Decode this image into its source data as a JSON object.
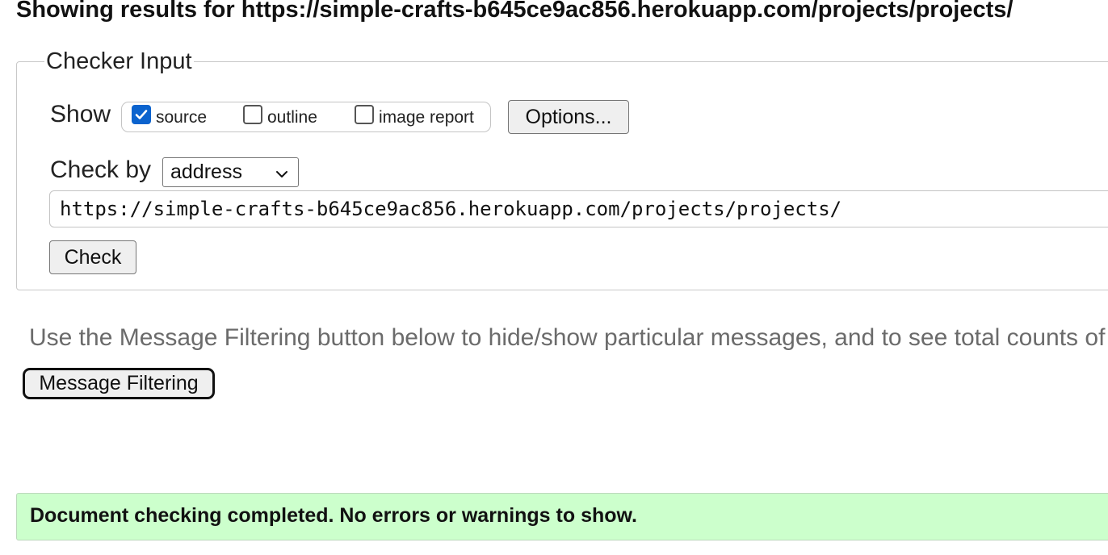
{
  "heading": "Showing results for https://simple-crafts-b645ce9ac856.herokuapp.com/projects/projects/",
  "checker": {
    "legend": "Checker Input",
    "show_label": "Show",
    "options": [
      {
        "label": "source",
        "checked": true
      },
      {
        "label": "outline",
        "checked": false
      },
      {
        "label": "image report",
        "checked": false
      }
    ],
    "options_button": "Options...",
    "check_by_label": "Check by",
    "check_by_value": "address",
    "url_value": "https://simple-crafts-b645ce9ac856.herokuapp.com/projects/projects/",
    "check_button": "Check"
  },
  "filtering": {
    "info_text": "Use the Message Filtering button below to hide/show particular messages, and to see total counts of errors and warnings.",
    "button_label": "Message Filtering"
  },
  "result": {
    "message": "Document checking completed. No errors or warnings to show."
  },
  "colors": {
    "checkbox_checked": "#0b63ce",
    "success_background": "#ccffcc",
    "muted_text": "#6b6b6b"
  },
  "icons": {
    "select_arrow": "chevron-down-icon",
    "checkmark": "checkmark-icon"
  }
}
